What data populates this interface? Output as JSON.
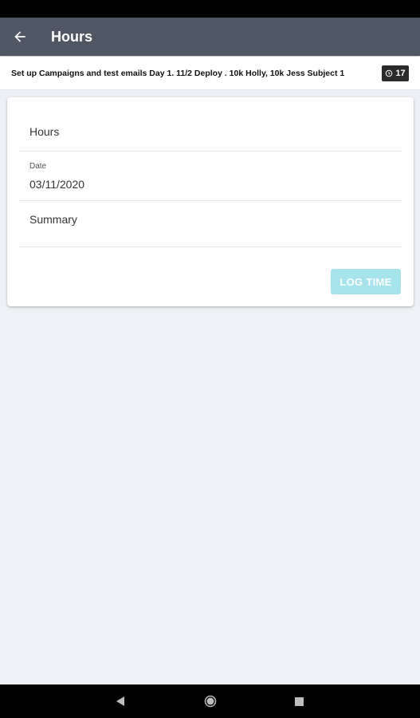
{
  "header": {
    "title": "Hours",
    "back_icon": "arrow-left-icon"
  },
  "task": {
    "title": "Set up Campaigns and test emails Day 1. 11/2 Deploy . 10k Holly, 10k Jess Subject 1",
    "badge_icon": "clock-icon",
    "badge_count": "17"
  },
  "form": {
    "hours_placeholder": "Hours",
    "date_label": "Date",
    "date_value": "03/11/2020",
    "summary_placeholder": "Summary",
    "submit_label": "LOG TIME"
  },
  "colors": {
    "app_bar": "#4e5763",
    "background": "#edf1f5",
    "button_disabled": "#a6e3ea"
  }
}
